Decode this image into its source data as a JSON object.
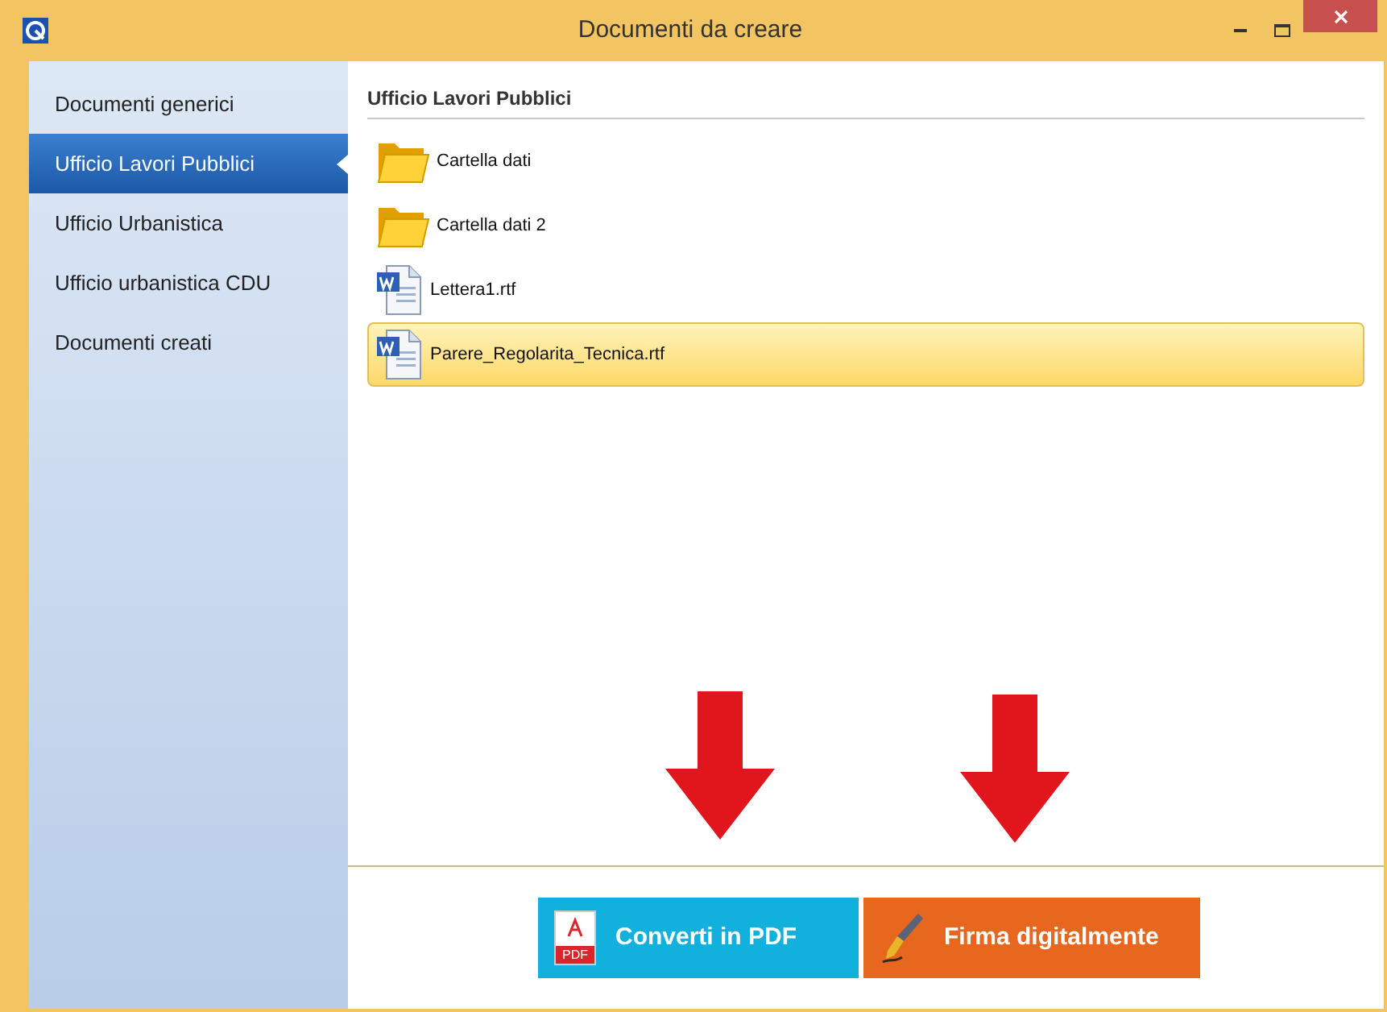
{
  "window": {
    "title": "Documenti da creare"
  },
  "sidebar": {
    "items": [
      {
        "label": "Documenti generici",
        "selected": false
      },
      {
        "label": "Ufficio Lavori Pubblici",
        "selected": true
      },
      {
        "label": "Ufficio Urbanistica",
        "selected": false
      },
      {
        "label": "Ufficio urbanistica CDU",
        "selected": false
      },
      {
        "label": "Documenti creati",
        "selected": false
      }
    ]
  },
  "content": {
    "heading": "Ufficio Lavori Pubblici",
    "files": [
      {
        "kind": "folder",
        "name": "Cartella dati",
        "selected": false
      },
      {
        "kind": "folder",
        "name": "Cartella dati 2",
        "selected": false
      },
      {
        "kind": "document",
        "name": "Lettera1.rtf",
        "selected": false
      },
      {
        "kind": "document",
        "name": "Parere_Regolarita_Tecnica.rtf",
        "selected": true
      }
    ]
  },
  "actions": [
    {
      "kind": "pdf",
      "label": "Converti in PDF",
      "icon_text": "PDF"
    },
    {
      "kind": "sign",
      "label": "Firma digitalmente"
    }
  ]
}
